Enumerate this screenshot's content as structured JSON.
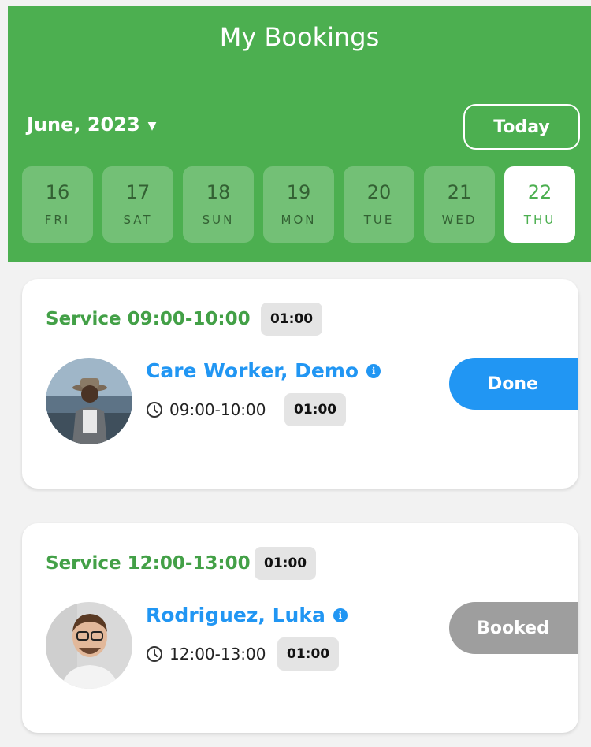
{
  "header": {
    "title": "My Bookings",
    "month_label": "June, 2023",
    "today_label": "Today"
  },
  "days": [
    {
      "num": "16",
      "name": "FRI",
      "selected": false
    },
    {
      "num": "17",
      "name": "SAT",
      "selected": false
    },
    {
      "num": "18",
      "name": "SUN",
      "selected": false
    },
    {
      "num": "19",
      "name": "MON",
      "selected": false
    },
    {
      "num": "20",
      "name": "TUE",
      "selected": false
    },
    {
      "num": "21",
      "name": "WED",
      "selected": false
    },
    {
      "num": "22",
      "name": "THU",
      "selected": true
    }
  ],
  "bookings": [
    {
      "service": "Service 09:00-10:00",
      "duration": "01:00",
      "worker": "Care Worker, Demo",
      "time": "09:00-10:00",
      "time_duration": "01:00",
      "status": "Done",
      "status_color": "#2196f3"
    },
    {
      "service": "Service 12:00-13:00",
      "duration": "01:00",
      "worker": "Rodriguez, Luka",
      "time": "12:00-13:00",
      "time_duration": "01:00",
      "status": "Booked",
      "status_color": "#9e9e9e"
    }
  ],
  "colors": {
    "header_bg": "#4caf50",
    "accent_blue": "#2196f3",
    "service_green": "#43a047"
  },
  "icons": {
    "month_dropdown": "caret-down-icon",
    "worker_info": "info-icon",
    "time": "clock-icon"
  }
}
